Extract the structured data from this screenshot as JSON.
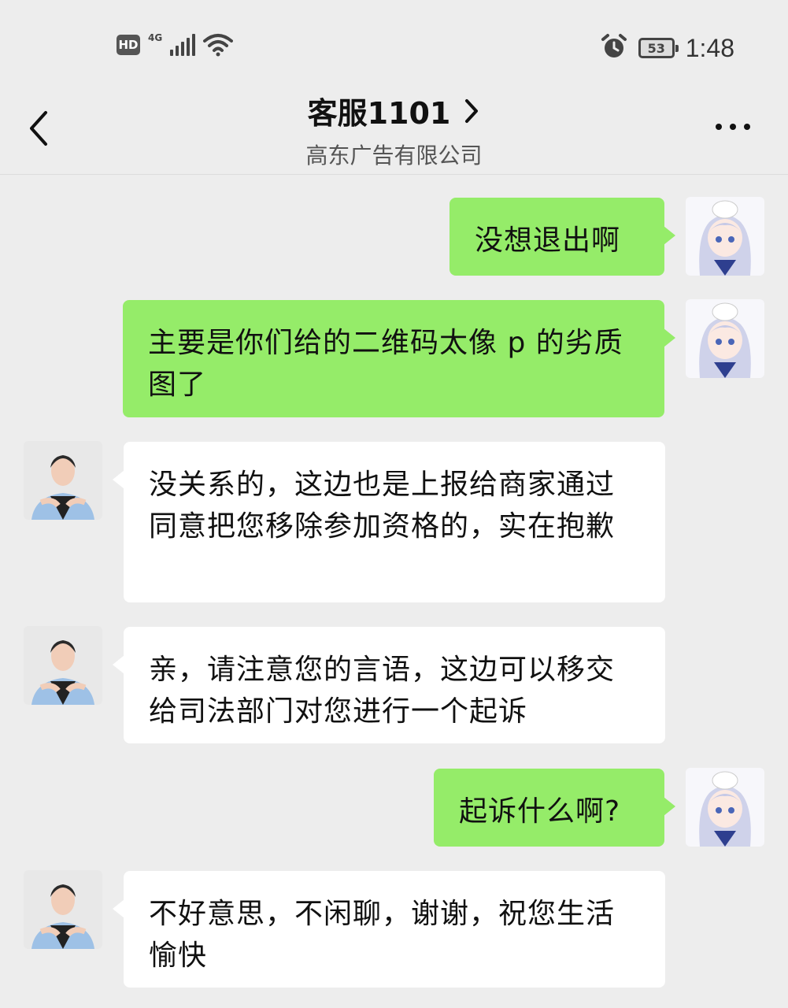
{
  "status_bar": {
    "hd": "HD",
    "network": "4G",
    "battery": "53",
    "time": "1:48"
  },
  "header": {
    "title": "客服1101",
    "subtitle": "高东广告有限公司"
  },
  "messages": [
    {
      "side": "out",
      "text": "没想退出啊"
    },
    {
      "side": "out",
      "text": "主要是你们给的二维码太像 p 的劣质图了"
    },
    {
      "side": "in",
      "text": "没关系的，这边也是上报给商家通过同意把您移除参加资格的，实在抱歉"
    },
    {
      "side": "in",
      "text": "亲，请注意您的言语，这边可以移交给司法部门对您进行一个起诉"
    },
    {
      "side": "out",
      "text": "起诉什么啊?"
    },
    {
      "side": "in",
      "text": "不好意思，不闲聊，谢谢，祝您生活愉快"
    }
  ],
  "colors": {
    "background": "#ededed",
    "outgoing_bubble": "#95ec69",
    "incoming_bubble": "#ffffff"
  },
  "icons": [
    "back-chevron-icon",
    "title-chevron-icon",
    "more-dots-icon",
    "alarm-icon",
    "wifi-icon",
    "signal-icon"
  ]
}
